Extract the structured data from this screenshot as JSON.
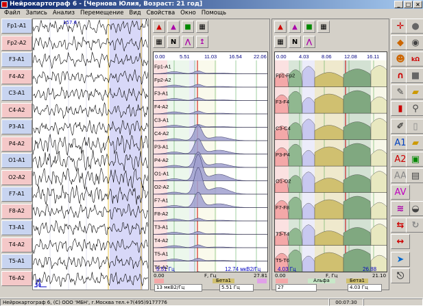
{
  "window": {
    "title": "Нейрокартограф 6 - [Чернова Юлия, Возраст: 21 год]",
    "buttons": [
      "_",
      "□",
      "×"
    ]
  },
  "menu": [
    "Файл",
    "Запись",
    "Анализ",
    "Перемещение",
    "Вид",
    "Свойства",
    "Окно",
    "Помощь"
  ],
  "channels": [
    "Fp1-A1",
    "Fp2-A2",
    "F3-A1",
    "F4-A2",
    "C3-A1",
    "C4-A2",
    "P3-A1",
    "P4-A2",
    "O1-A1",
    "O2-A2",
    "F7-A1",
    "F8-A2",
    "T3-A1",
    "T4-A2",
    "T5-A1",
    "T6-A2"
  ],
  "eeg": {
    "top_label": "157.6",
    "scale_mark": "50"
  },
  "spectrum_left": {
    "freq_ticks": [
      "0.00",
      "5.51",
      "11.03",
      "16.54",
      "22.06"
    ],
    "rows": [
      "Fp1-A1",
      "Fp2-A2",
      "F3-A1",
      "F4-A2",
      "C3-A1",
      "C4-A2",
      "P3-A1",
      "P4-A2",
      "O1-A1",
      "O2-A2",
      "F7-A1",
      "F8-A2",
      "T3-A1",
      "T4-A2",
      "T5-A1",
      "T6-A2"
    ],
    "bottom_left": "5.51 Гц",
    "bottom_right": "12.74 мкВ2/Гц",
    "axis_start": "0.00",
    "axis_label": "F, Гц",
    "axis_end": "27.81",
    "band": "Бета1",
    "field_left": "13 мкВ2/Гц",
    "field_right": "5.51 Гц"
  },
  "spectrum_right": {
    "freq_ticks": [
      "0.00",
      "4.03",
      "8.06",
      "12.08",
      "16.11"
    ],
    "rows": [
      "Fp1-Fp2",
      "F3-F4",
      "C3-C4",
      "P3-P4",
      "O1-O2",
      "F7-F8",
      "T3-T4",
      "T5-T6"
    ],
    "bottom_left": "4.03 Гц",
    "bottom_right": "26.88",
    "axis_start": "0.00",
    "axis_label": "F, Гц",
    "axis_end": "21.10",
    "band_left": "Альфа",
    "band": "Бета1",
    "field_left": "27",
    "field_right": "4.03 Гц"
  },
  "right_tools": [
    "A1",
    "A2",
    "AA",
    "AV"
  ],
  "status": {
    "copyright": "Нейрокартограф 6, (С) ООО 'МБН', г.Москва тел.+7(495)9177776",
    "time": "00:07:30"
  },
  "colors": {
    "title_start": "#0a246a",
    "title_end": "#a6caf0",
    "chan_pink": "#f4c8c8",
    "chan_blue": "#c8d4f0",
    "eeg_bg": "#ffffff",
    "eeg_band": "#d8d8f8"
  }
}
